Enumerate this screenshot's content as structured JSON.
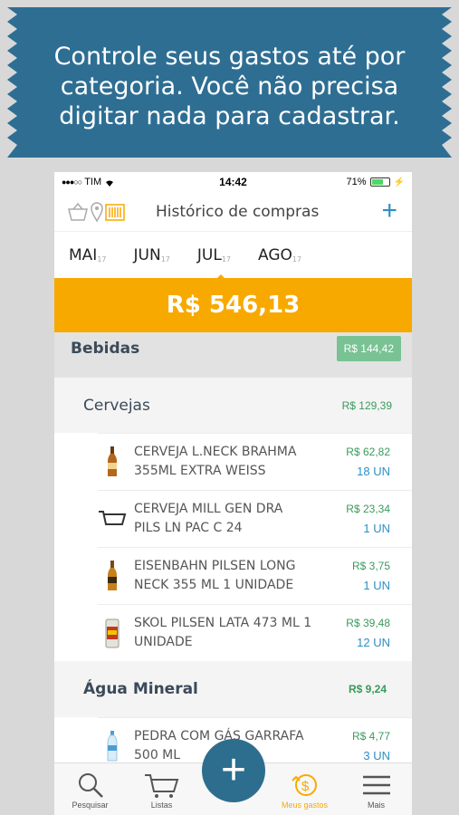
{
  "banner": {
    "line1": "Controle seus gastos até por",
    "line2": "categoria. Você não precisa",
    "line3": "digitar nada para cadastrar."
  },
  "statusbar": {
    "carrier": "TIM",
    "time": "14:42",
    "battery": "71%"
  },
  "navbar": {
    "title": "Histórico de compras",
    "add": "+"
  },
  "months": [
    {
      "label": "MAI",
      "year": "17"
    },
    {
      "label": "JUN",
      "year": "17"
    },
    {
      "label": "JUL",
      "year": "17"
    },
    {
      "label": "AGO",
      "year": "17"
    }
  ],
  "total": "R$ 546,13",
  "category": {
    "name": "Bebidas",
    "value": "R$ 144,42"
  },
  "subcategories": [
    {
      "name": "Cervejas",
      "value": "R$ 129,39",
      "items": [
        {
          "line1": "CERVEJA L.NECK BRAHMA",
          "line2": "355ML EXTRA WEISS",
          "price": "R$ 62,82",
          "qty": "18 UN",
          "icon": "beer-bottle-icon"
        },
        {
          "line1": "CERVEJA MILL GEN DRA",
          "line2": "PILS LN PAC C 24",
          "price": "R$ 23,34",
          "qty": "1 UN",
          "icon": "cart-icon"
        },
        {
          "line1": "EISENBAHN PILSEN LONG",
          "line2": "NECK 355 ML 1 UNIDADE",
          "price": "R$ 3,75",
          "qty": "1 UN",
          "icon": "beer-bottle-icon"
        },
        {
          "line1": "SKOL PILSEN LATA 473 ML 1",
          "line2": "UNIDADE",
          "price": "R$ 39,48",
          "qty": "12 UN",
          "icon": "beer-can-icon"
        }
      ]
    },
    {
      "name": "Água Mineral",
      "value": "R$ 9,24",
      "items": [
        {
          "line1": "PEDRA COM GÁS GARRAFA",
          "line2": "500 ML",
          "price": "R$ 4,77",
          "qty": "3 UN",
          "icon": "water-bottle-icon"
        }
      ]
    }
  ],
  "tabbar": {
    "search": "Pesquisar",
    "lists": "Listas",
    "expenses": "Meus gastos",
    "more": "Mais"
  },
  "colors": {
    "accent": "#f8a900",
    "brand": "#2d6e8e",
    "banner": "#2e6e93",
    "price": "#3a9a5c",
    "qty": "#2d8fc4"
  }
}
